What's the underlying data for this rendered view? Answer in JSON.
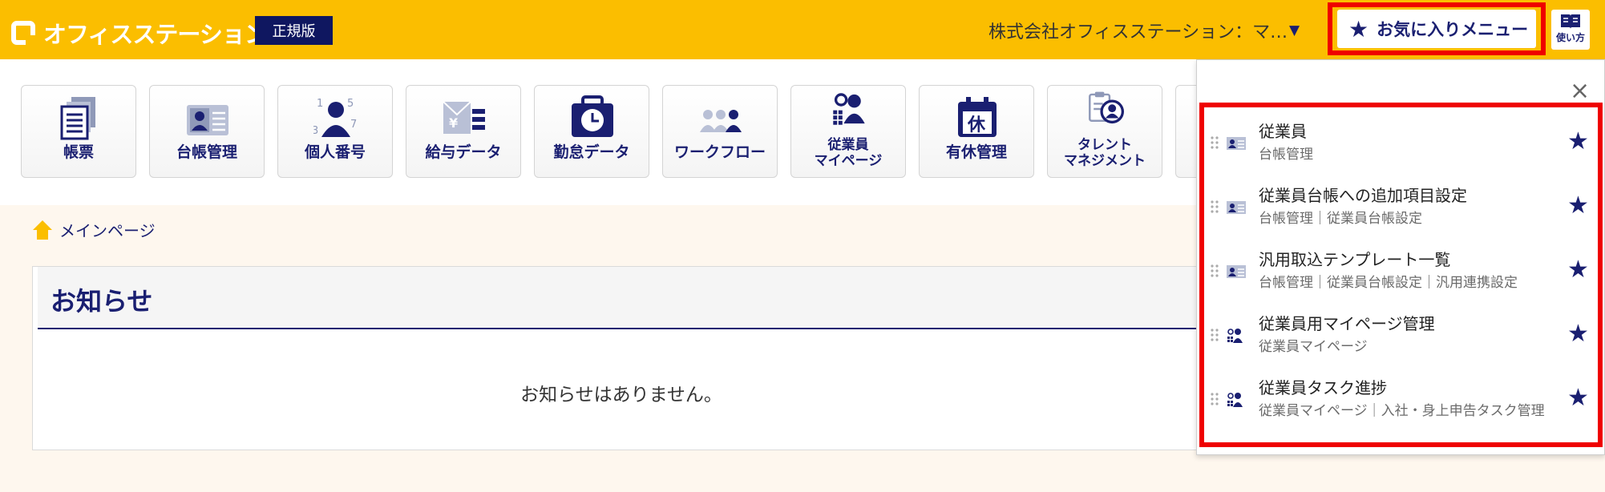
{
  "header": {
    "logo_text": "オフィスステーション",
    "edition_badge": "正規版",
    "company_name": "株式会社オフィスステーション：マ…",
    "company_caret": "▼",
    "favorites_button": "お気に入りメニュー",
    "help_label": "使い方"
  },
  "toolbar": {
    "items": [
      {
        "label": "帳票",
        "icon": "document-stack-icon"
      },
      {
        "label": "台帳管理",
        "icon": "ledger-card-icon"
      },
      {
        "label": "個人番号",
        "icon": "personal-number-icon"
      },
      {
        "label": "給与データ",
        "icon": "salary-data-icon"
      },
      {
        "label": "勤怠データ",
        "icon": "attendance-clock-icon"
      },
      {
        "label": "ワークフロー",
        "icon": "workflow-icon"
      },
      {
        "label_line1": "従業員",
        "label_line2": "マイページ",
        "icon": "employee-mypage-icon"
      },
      {
        "label": "有休管理",
        "icon": "paid-leave-calendar-icon"
      },
      {
        "label_line1": "タレント",
        "label_line2": "マネジメント",
        "icon": "talent-management-icon"
      }
    ]
  },
  "main": {
    "breadcrumb": "メインページ",
    "notice_title": "お知らせ",
    "notice_empty": "お知らせはありません。"
  },
  "favorites_panel": {
    "close_icon": "×",
    "items": [
      {
        "name": "従業員",
        "path": "台帳管理",
        "icon": "ledger-card-icon"
      },
      {
        "name": "従業員台帳への追加項目設定",
        "path": "台帳管理｜従業員台帳設定",
        "icon": "ledger-card-icon"
      },
      {
        "name": "汎用取込テンプレート一覧",
        "path": "台帳管理｜従業員台帳設定｜汎用連携設定",
        "icon": "ledger-card-icon"
      },
      {
        "name": "従業員用マイページ管理",
        "path": "従業員マイページ",
        "icon": "employee-mypage-icon"
      },
      {
        "name": "従業員タスク進捗",
        "path": "従業員マイページ｜入社・身上申告タスク管理",
        "icon": "employee-mypage-icon"
      }
    ]
  },
  "colors": {
    "header_bg": "#fbbe00",
    "navy": "#1a1f71",
    "highlight_red": "#ef0000",
    "main_bg": "#fef7ee"
  }
}
